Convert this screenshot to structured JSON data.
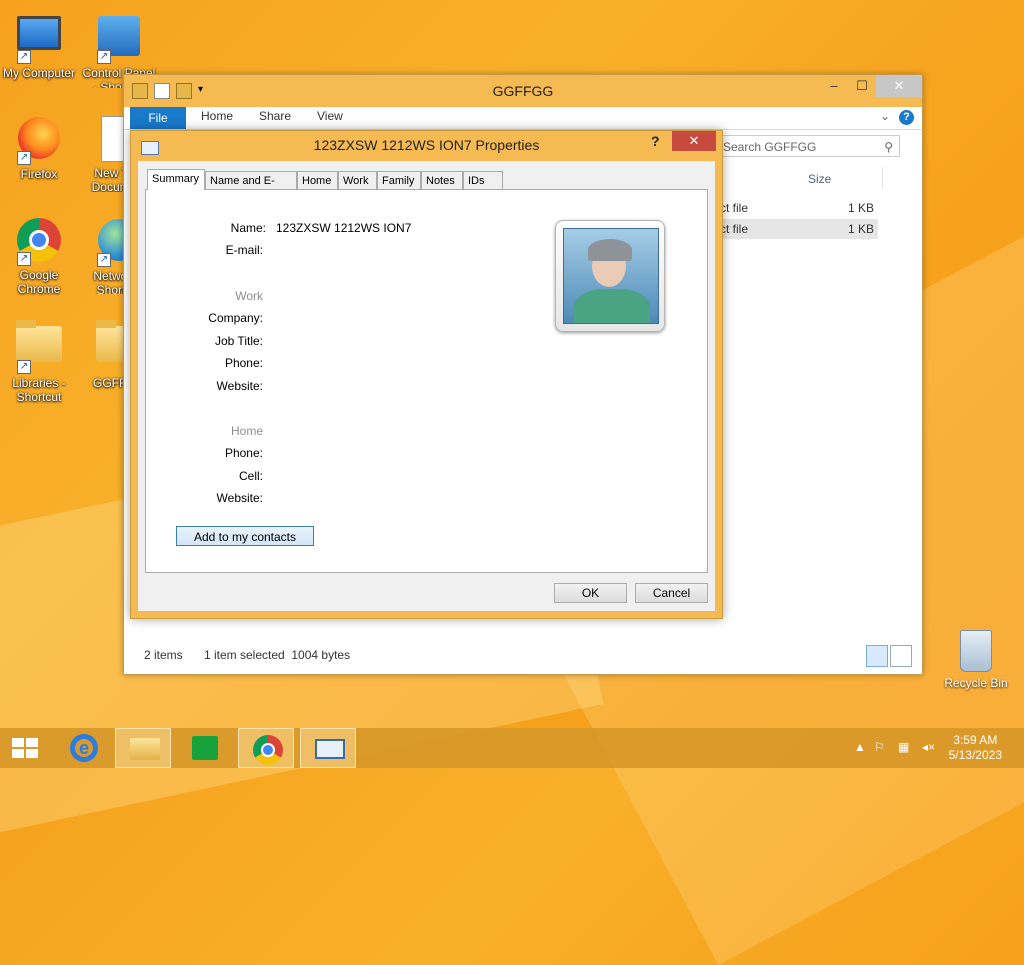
{
  "desktop": {
    "icons": [
      {
        "label": "My Computer",
        "icon": "computer-icon"
      },
      {
        "label": "Control Panel - Shortcut",
        "icon": "control-panel-icon"
      },
      {
        "label": "Firefox",
        "icon": "firefox-icon"
      },
      {
        "label": "New Text Document",
        "icon": "document-icon"
      },
      {
        "label": "Google Chrome",
        "icon": "chrome-icon"
      },
      {
        "label": "Network - Shortcut",
        "icon": "network-icon"
      },
      {
        "label": "Libraries - Shortcut",
        "icon": "libraries-icon"
      },
      {
        "label": "GGFFGG",
        "icon": "folder-icon"
      }
    ],
    "recycle_bin": "Recycle Bin"
  },
  "explorer": {
    "title": "GGFFGG",
    "ribbon_tabs": [
      "File",
      "Home",
      "Share",
      "View"
    ],
    "search_placeholder": "Search GGFFGG",
    "column_size": "Size",
    "files": [
      {
        "name": "ct file",
        "size": "1 KB",
        "selected": false
      },
      {
        "name": "ct file",
        "size": "1 KB",
        "selected": true
      }
    ],
    "status_items": "2 items",
    "status_selected": "1 item selected  1004 bytes"
  },
  "dialog": {
    "title": "123ZXSW 1212WS ION7 Properties",
    "help": "?",
    "tabs": [
      "Summary",
      "Name and E-mail",
      "Home",
      "Work",
      "Family",
      "Notes",
      "IDs"
    ],
    "name_label": "Name:",
    "name_value": "123ZXSW 1212WS ION7",
    "email_label": "E-mail:",
    "work_section": "Work",
    "company_label": "Company:",
    "jobtitle_label": "Job Title:",
    "work_phone_label": "Phone:",
    "work_website_label": "Website:",
    "home_section": "Home",
    "home_phone_label": "Phone:",
    "cell_label": "Cell:",
    "home_website_label": "Website:",
    "add_contacts": "Add to my contacts",
    "ok": "OK",
    "cancel": "Cancel"
  },
  "taskbar": {
    "time": "3:59 AM",
    "date": "5/13/2023"
  }
}
